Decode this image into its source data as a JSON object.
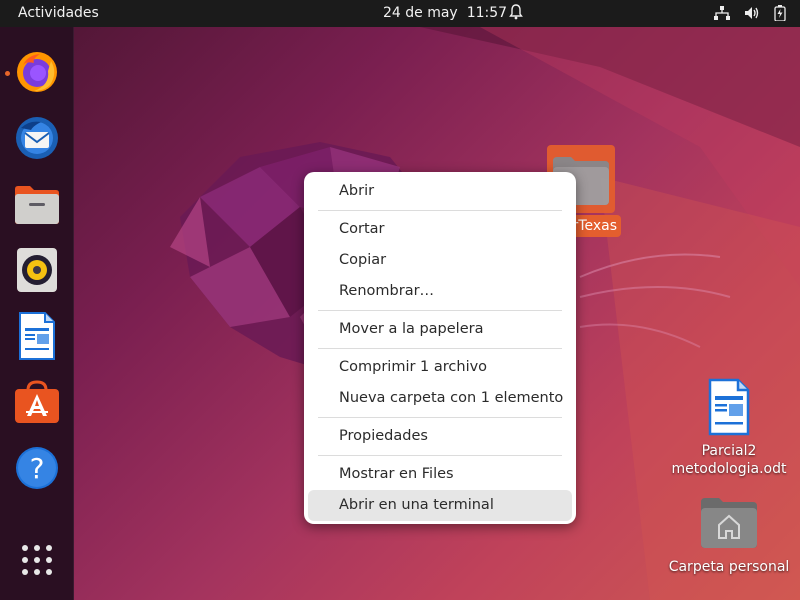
{
  "topbar": {
    "activities": "Actividades",
    "date": "24 de may",
    "time": "11:57",
    "icons": [
      "bell-icon",
      "network-icon",
      "volume-icon",
      "battery-icon"
    ]
  },
  "dock": {
    "apps": [
      {
        "name": "firefox-icon",
        "running": true
      },
      {
        "name": "thunderbird-icon",
        "running": false
      },
      {
        "name": "files-icon",
        "running": false
      },
      {
        "name": "rhythmbox-icon",
        "running": false
      },
      {
        "name": "writer-icon",
        "running": false
      },
      {
        "name": "software-icon",
        "running": false
      },
      {
        "name": "help-icon",
        "running": false
      }
    ],
    "show_apps": "grid-icon"
  },
  "desktop": {
    "selected_folder_label": "rTexas",
    "file_label_1": "Parcial2",
    "file_label_2": "metodologia.odt",
    "home_label": "Carpeta personal"
  },
  "context_menu": {
    "open": "Abrir",
    "cut": "Cortar",
    "copy": "Copiar",
    "rename": "Renombrar…",
    "trash": "Mover a la papelera",
    "compress": "Comprimir 1 archivo",
    "new_folder": "Nueva carpeta con 1 elemento",
    "properties": "Propiedades",
    "show_in_files": "Mostrar en Files",
    "open_terminal": "Abrir en una terminal",
    "hovered_item": "open_terminal"
  },
  "colors": {
    "accent": "#e45e2e",
    "topbar": "#1b1b1b",
    "dock": "#2a0f22"
  }
}
